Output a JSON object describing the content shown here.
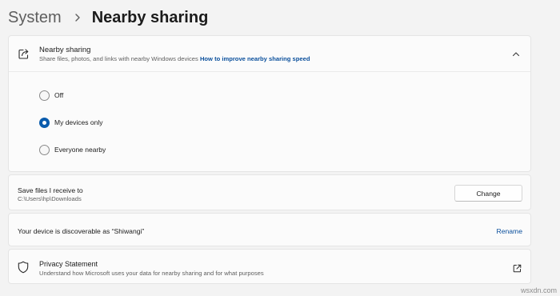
{
  "breadcrumb": {
    "parent": "System",
    "separator_icon": "chevron-right-icon",
    "current": "Nearby sharing"
  },
  "nearby_sharing": {
    "icon": "share-icon",
    "title": "Nearby sharing",
    "description": "Share files, photos, and links with nearby Windows devices",
    "link": "How to improve nearby sharing speed",
    "expanded": true,
    "options": [
      {
        "label": "Off",
        "selected": false
      },
      {
        "label": "My devices only",
        "selected": true
      },
      {
        "label": "Everyone nearby",
        "selected": false
      }
    ]
  },
  "save_files": {
    "title": "Save files I receive to",
    "path": "C:\\Users\\hp\\Downloads",
    "button_label": "Change"
  },
  "discoverable": {
    "text": "Your device is discoverable as “Shiwangi”",
    "action_label": "Rename"
  },
  "privacy": {
    "icon": "shield-icon",
    "title": "Privacy Statement",
    "description": "Understand how Microsoft uses your data for nearby sharing and for what purposes",
    "action_icon": "external-link-icon"
  },
  "watermark": "wsxdn.com",
  "colors": {
    "accent": "#0a5cad",
    "link": "#0a4f9c",
    "background": "#f3f3f3",
    "card": "#fbfbfb"
  }
}
